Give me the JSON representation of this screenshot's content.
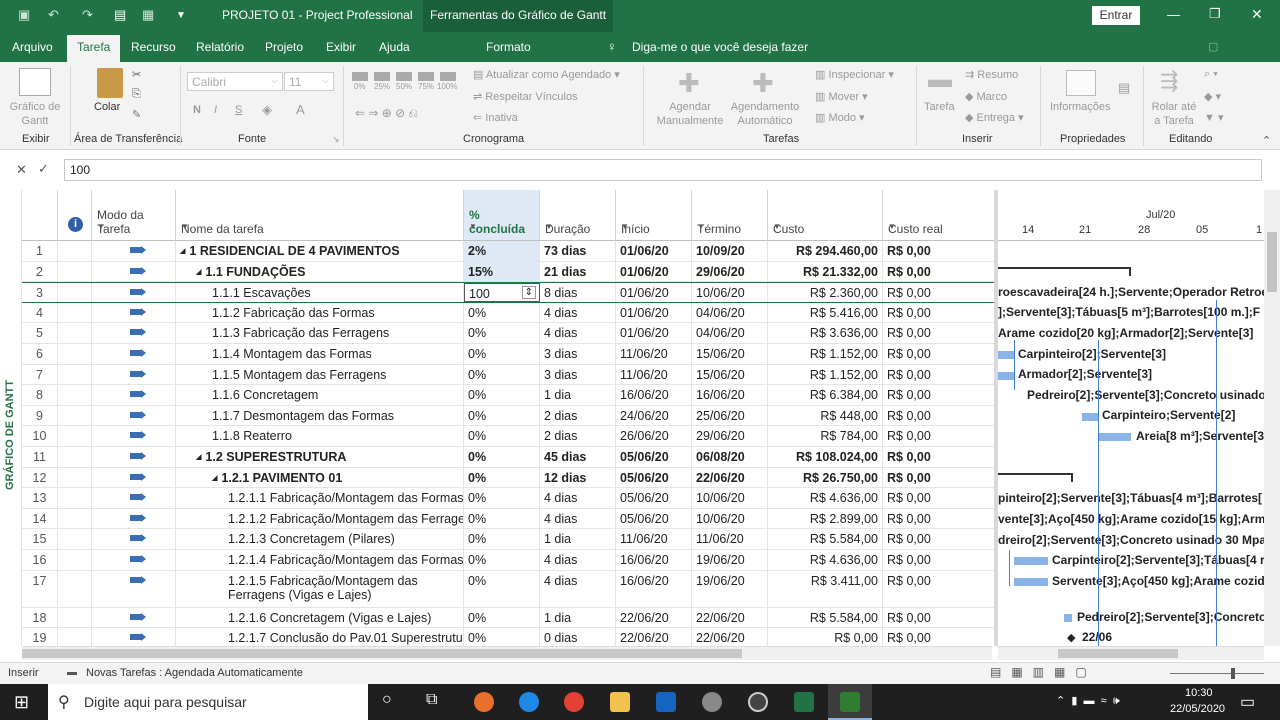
{
  "titlebar": {
    "doc_title": "PROJETO 01 - Project Professional",
    "context_title": "Ferramentas do Gráfico de Gantt",
    "signin": "Entrar",
    "minimize": "—",
    "restore": "❐",
    "close": "✕"
  },
  "ribbon_tabs": [
    "Arquivo",
    "Tarefa",
    "Recurso",
    "Relatório",
    "Projeto",
    "Exibir",
    "Ajuda",
    "Formato"
  ],
  "tell_me": "Diga-me o que você deseja fazer",
  "ribbon": {
    "gantt_label": "Gráfico de\nGantt",
    "group_exibir": "Exibir",
    "paste": "Colar",
    "group_clipboard": "Área de Transferência",
    "font_name": "Calibri",
    "font_size": "11",
    "bold": "N",
    "italic": "I",
    "underline": "S",
    "group_fonte": "Fonte",
    "pcts": [
      "0%",
      "25%",
      "50%",
      "75%",
      "100%"
    ],
    "update_sched": "Atualizar como Agendado",
    "respect_links": "Respeitar Vínculos",
    "inactive": "Inativa",
    "group_cronograma": "Cronograma",
    "manual": "Agendar\nManualmente",
    "auto": "Agendamento\nAutomático",
    "inspect": "Inspecionar",
    "move": "Mover",
    "mode": "Modo",
    "group_tarefas": "Tarefas",
    "task": "Tarefa",
    "summary": "Resumo",
    "milestone": "Marco",
    "deliverable": "Entrega",
    "group_inserir": "Inserir",
    "info": "Informações",
    "group_props": "Propriedades",
    "scroll": "Rolar até\na Tarefa",
    "group_edit": "Editando"
  },
  "formula": {
    "cancel": "✕",
    "accept": "✓",
    "value": "100"
  },
  "columns": {
    "mode": "Modo da\nTarefa",
    "name": "Nome da tarefa",
    "pct": "%\nconcluída",
    "dur": "Duração",
    "start": "Início",
    "end": "Término",
    "cost": "Custo",
    "actual": "Custo real",
    "info_icon": "i"
  },
  "rows": [
    {
      "n": "1",
      "name": "1 RESIDENCIAL DE 4 PAVIMENTOS",
      "indent": 0,
      "bold": true,
      "tri": "◢",
      "pct": "2%",
      "dur": "73 dias",
      "start": "01/06/20",
      "end": "10/09/20",
      "cost": "R$ 294.460,00",
      "actual": "R$ 0,00"
    },
    {
      "n": "2",
      "name": "1.1 FUNDAÇÕES",
      "indent": 1,
      "bold": true,
      "tri": "◢",
      "pct": "15%",
      "dur": "21 dias",
      "start": "01/06/20",
      "end": "29/06/20",
      "cost": "R$ 21.332,00",
      "actual": "R$ 0,00"
    },
    {
      "n": "3",
      "name": "1.1.1 Escavações",
      "indent": 2,
      "bold": false,
      "tri": "",
      "pct": "100",
      "dur": "8 dias",
      "start": "01/06/20",
      "end": "10/06/20",
      "cost": "R$ 2.360,00",
      "actual": "R$ 0,00"
    },
    {
      "n": "4",
      "name": "1.1.2 Fabricação das Formas",
      "indent": 2,
      "bold": false,
      "tri": "",
      "pct": "0%",
      "dur": "4 dias",
      "start": "01/06/20",
      "end": "04/06/20",
      "cost": "R$ 5.416,00",
      "actual": "R$ 0,00"
    },
    {
      "n": "5",
      "name": "1.1.3 Fabricação das Ferragens",
      "indent": 2,
      "bold": false,
      "tri": "",
      "pct": "0%",
      "dur": "4 dias",
      "start": "01/06/20",
      "end": "04/06/20",
      "cost": "R$ 3.636,00",
      "actual": "R$ 0,00"
    },
    {
      "n": "6",
      "name": "1.1.4 Montagem das Formas",
      "indent": 2,
      "bold": false,
      "tri": "",
      "pct": "0%",
      "dur": "3 dias",
      "start": "11/06/20",
      "end": "15/06/20",
      "cost": "R$ 1.152,00",
      "actual": "R$ 0,00"
    },
    {
      "n": "7",
      "name": "1.1.5 Montagem das Ferragens",
      "indent": 2,
      "bold": false,
      "tri": "",
      "pct": "0%",
      "dur": "3 dias",
      "start": "11/06/20",
      "end": "15/06/20",
      "cost": "R$ 1.152,00",
      "actual": "R$ 0,00"
    },
    {
      "n": "8",
      "name": "1.1.6 Concretagem",
      "indent": 2,
      "bold": false,
      "tri": "",
      "pct": "0%",
      "dur": "1 dia",
      "start": "16/06/20",
      "end": "16/06/20",
      "cost": "R$ 6.384,00",
      "actual": "R$ 0,00"
    },
    {
      "n": "9",
      "name": "1.1.7 Desmontagem das Formas",
      "indent": 2,
      "bold": false,
      "tri": "",
      "pct": "0%",
      "dur": "2 dias",
      "start": "24/06/20",
      "end": "25/06/20",
      "cost": "R$ 448,00",
      "actual": "R$ 0,00"
    },
    {
      "n": "10",
      "name": "1.1.8 Reaterro",
      "indent": 2,
      "bold": false,
      "tri": "",
      "pct": "0%",
      "dur": "2 dias",
      "start": "26/06/20",
      "end": "29/06/20",
      "cost": "R$ 784,00",
      "actual": "R$ 0,00"
    },
    {
      "n": "11",
      "name": "1.2 SUPERESTRUTURA",
      "indent": 1,
      "bold": true,
      "tri": "◢",
      "pct": "0%",
      "dur": "45 dias",
      "start": "05/06/20",
      "end": "06/08/20",
      "cost": "R$ 108.024,00",
      "actual": "R$ 0,00"
    },
    {
      "n": "12",
      "name": "1.2.1 PAVIMENTO 01",
      "indent": 2,
      "bold": true,
      "tri": "◢",
      "pct": "0%",
      "dur": "12 dias",
      "start": "05/06/20",
      "end": "22/06/20",
      "cost": "R$ 26.750,00",
      "actual": "R$ 0,00"
    },
    {
      "n": "13",
      "name": "1.2.1.1 Fabricação/Montagem das Formas",
      "indent": 3,
      "bold": false,
      "tri": "",
      "pct": "0%",
      "dur": "4 dias",
      "start": "05/06/20",
      "end": "10/06/20",
      "cost": "R$ 4.636,00",
      "actual": "R$ 0,00"
    },
    {
      "n": "14",
      "name": "1.2.1.2 Fabricação/Montagem das Ferragens",
      "indent": 3,
      "bold": false,
      "tri": "",
      "pct": "0%",
      "dur": "4 dias",
      "start": "05/06/20",
      "end": "10/06/20",
      "cost": "R$ 2.899,00",
      "actual": "R$ 0,00"
    },
    {
      "n": "15",
      "name": "1.2.1.3 Concretagem (Pilares)",
      "indent": 3,
      "bold": false,
      "tri": "",
      "pct": "0%",
      "dur": "1 dia",
      "start": "11/06/20",
      "end": "11/06/20",
      "cost": "R$ 5.584,00",
      "actual": "R$ 0,00"
    },
    {
      "n": "16",
      "name": "1.2.1.4 Fabricação/Montagem das Formas",
      "indent": 3,
      "bold": false,
      "tri": "",
      "pct": "0%",
      "dur": "4 dias",
      "start": "16/06/20",
      "end": "19/06/20",
      "cost": "R$ 4.636,00",
      "actual": "R$ 0,00"
    },
    {
      "n": "17",
      "name": "1.2.1.5 Fabricação/Montagem das",
      "name2": "Ferragens (Vigas e Lajes)",
      "indent": 3,
      "bold": false,
      "tri": "",
      "pct": "0%",
      "dur": "4 dias",
      "start": "16/06/20",
      "end": "19/06/20",
      "cost": "R$ 3.411,00",
      "actual": "R$ 0,00"
    },
    {
      "n": "18",
      "name": "1.2.1.6 Concretagem (Vigas e Lajes)",
      "indent": 3,
      "bold": false,
      "tri": "",
      "pct": "0%",
      "dur": "1 dia",
      "start": "22/06/20",
      "end": "22/06/20",
      "cost": "R$ 5.584,00",
      "actual": "R$ 0,00"
    },
    {
      "n": "19",
      "name": "1.2.1.7 Conclusão do Pav.01 Superestrutura",
      "indent": 3,
      "bold": false,
      "tri": "",
      "pct": "0%",
      "dur": "0 dias",
      "start": "22/06/20",
      "end": "22/06/20",
      "cost": "R$ 0,00",
      "actual": "R$ 0,00"
    }
  ],
  "gantt": {
    "month": "Jul/20",
    "days": [
      "14",
      "21",
      "28",
      "05",
      "1"
    ],
    "labels": [
      "roescavadeira[24 h.];Servente;Operador Retroe",
      "];Servente[3];Tábuas[5 m³];Barrotes[100 m.];F",
      "Arame cozido[20 kg];Armador[2];Servente[3]",
      "Carpinteiro[2];Servente[3]",
      "Armador[2];Servente[3]",
      "Pedreiro[2];Servente[3];Concreto usinado",
      "Carpinteiro;Servente[2]",
      "Areia[8 m³];Servente[3",
      "pinteiro[2];Servente[3];Tábuas[4 m³];Barrotes[",
      "vente[3];Aço[450 kg];Arame cozido[15 kg];Arm",
      "dreiro[2];Servente[3];Concreto usinado 30 Mpa",
      "Carpinteiro[2];Servente[3];Tábuas[4 r",
      "Servente[3];Aço[450 kg];Arame cozid",
      "Pedreiro[2];Servente[3];Concreto",
      "22/06"
    ]
  },
  "side_label": "GRÁFICO DE GANTT",
  "status": {
    "mode": "Inserir",
    "new_tasks": "Novas Tarefas : Agendada Automaticamente"
  },
  "taskbar": {
    "search": "Digite aqui para pesquisar",
    "time": "10:30",
    "date": "22/05/2020"
  },
  "colors": {
    "accent": "#217346",
    "selected_col": "#dfe9f6",
    "gantt_bar": "#8ab4e8"
  }
}
